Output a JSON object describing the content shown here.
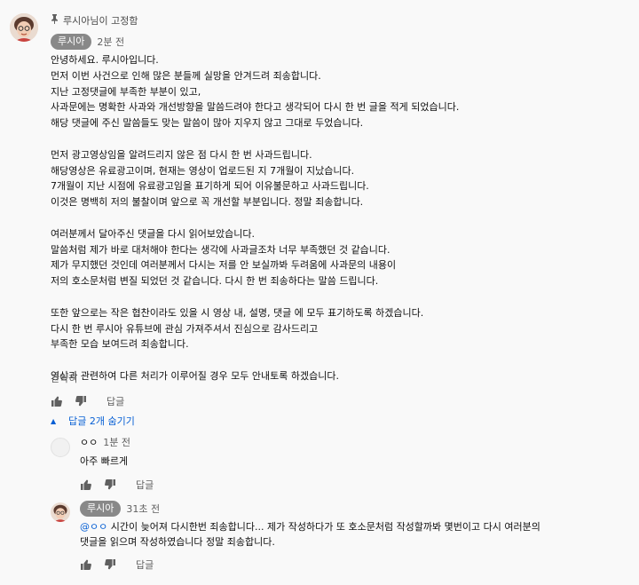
{
  "pinned": {
    "pin_label": "루시아님이 고정함",
    "author": "루시아",
    "time": "2분 전",
    "body": "안녕하세요. 루시아입니다.\n먼저 이번 사건으로 인해 많은 분들께 실망을 안겨드려 죄송합니다.\n지난 고정댓글에 부족한 부분이 있고,\n사과문에는 명확한 사과와 개선방향을 말씀드려야 한다고 생각되어 다시 한 번 글을 적게 되었습니다.\n해당 댓글에 주신 말씀들도 맞는 말씀이 많아 지우지 않고 그대로 두었습니다.\n\n먼저 광고영상임을 알려드리지 않은 점 다시 한 번 사과드립니다.\n해당영상은 유료광고이며, 현재는 영상이 업로드된 지 7개월이 지났습니다.\n7개월이 지난 시점에 유료광고임을 표기하게 되어 이유불문하고 사과드립니다.\n이것은 명백히 저의 불찰이며 앞으로 꼭 개선할 부분입니다. 정말 죄송합니다.\n\n여러분께서 달아주신 댓글을 다시 읽어보았습니다.\n말씀처럼 제가 바로 대처해야 한다는 생각에 사과글조차 너무 부족했던 것 같습니다.\n제가 무지했던 것인데 여러분께서 다시는 저를 안 보실까봐 두려움에 사과문의 내용이\n저의 호소문처럼 변질 되었던 것 같습니다. 다시 한 번 죄송하다는 말씀 드립니다.\n\n또한 앞으로는 작은 협찬이라도 있을 시 영상 내, 설명, 댓글 에 모두 표기하도록 하겠습니다.\n다시 한 번 루시아 유튜브에 관심 가져주셔서 진심으로 감사드리고\n부족한 모습 보여드려 죄송합니다.\n\n영상과 관련하여 다른 처리가 이루어질 경우 모두 안내토록 하겠습니다.",
    "collapse": "간략히",
    "reply_button": "답글"
  },
  "replies_toggle": "답글 2개 숨기기",
  "replies": [
    {
      "author": "ㅇㅇ",
      "time": "1분 전",
      "text": "아주 빠르게",
      "reply_button": "답글"
    },
    {
      "author": "루시아",
      "time": "31초 전",
      "mention": "@ㅇㅇ",
      "text": " 시간이 늦어져 다시한번 죄송합니다... 제가 작성하다가 또 호소문처럼 작성할까봐 몇번이고 다시 여러분의\n댓글을 읽으며 작성하였습니다 정말 죄송합니다.",
      "reply_button": "답글"
    }
  ],
  "colors": {
    "link": "#065fd4",
    "badge": "#888888",
    "meta": "#606060",
    "background": "#f9f9f9"
  },
  "icons": [
    "pin-icon",
    "thumb-up-icon",
    "thumb-down-icon",
    "caret-up-icon"
  ]
}
